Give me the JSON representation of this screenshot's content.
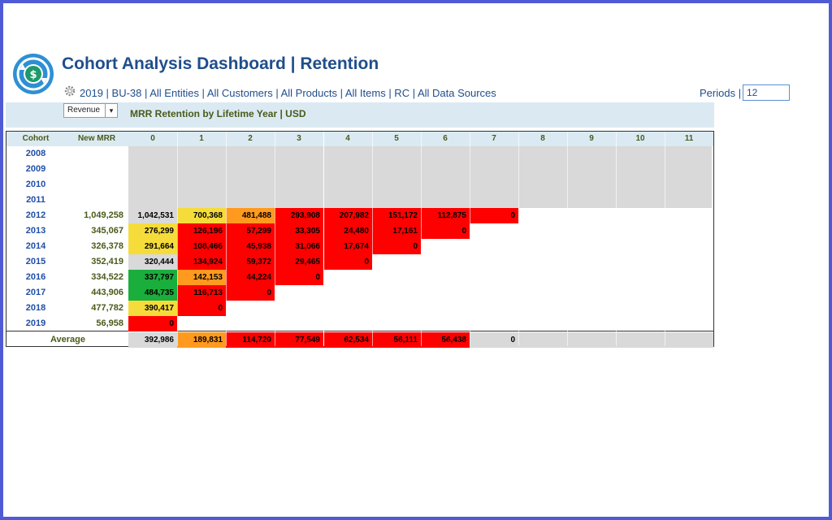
{
  "dashboard": {
    "title": "Cohort Analysis Dashboard | Retention",
    "filters": "2019 | BU-38 | All Entities | All Customers | All Products | All Items | RC | All Data Sources",
    "periods_label": "Periods |",
    "periods_value": "12",
    "metric_select": "Revenue",
    "subtitle": "MRR Retention by Lifetime Year | USD"
  },
  "colors": {
    "red": "#ff0000",
    "orange": "#ff9a1f",
    "yellow": "#f5dc3b",
    "green": "#1aae3c",
    "gray": "#d9d9d9",
    "header": "#dbeaf2",
    "accent": "#1f4e8c"
  },
  "icons": {
    "logo": "dollar-cycle-icon",
    "settings": "gear-icon",
    "dropdown": "chevron-down-icon"
  },
  "table": {
    "headers": {
      "cohort": "Cohort",
      "new_mrr": "New MRR",
      "periods": [
        "0",
        "1",
        "2",
        "3",
        "4",
        "5",
        "6",
        "7",
        "8",
        "9",
        "10",
        "11"
      ]
    },
    "rows": [
      {
        "cohort": "2008",
        "new_mrr": "",
        "cells": []
      },
      {
        "cohort": "2009",
        "new_mrr": "",
        "cells": []
      },
      {
        "cohort": "2010",
        "new_mrr": "",
        "cells": []
      },
      {
        "cohort": "2011",
        "new_mrr": "",
        "cells": []
      },
      {
        "cohort": "2012",
        "new_mrr": "1,049,258",
        "cells": [
          {
            "v": "1,042,531",
            "c": "gray"
          },
          {
            "v": "700,368",
            "c": "yellow"
          },
          {
            "v": "481,488",
            "c": "orange"
          },
          {
            "v": "293,908",
            "c": "red"
          },
          {
            "v": "207,982",
            "c": "red"
          },
          {
            "v": "151,172",
            "c": "red"
          },
          {
            "v": "112,875",
            "c": "red"
          },
          {
            "v": "0",
            "c": "red"
          }
        ]
      },
      {
        "cohort": "2013",
        "new_mrr": "345,067",
        "cells": [
          {
            "v": "276,299",
            "c": "yellow"
          },
          {
            "v": "126,196",
            "c": "red"
          },
          {
            "v": "57,299",
            "c": "red"
          },
          {
            "v": "33,305",
            "c": "red"
          },
          {
            "v": "24,480",
            "c": "red"
          },
          {
            "v": "17,161",
            "c": "red"
          },
          {
            "v": "0",
            "c": "red"
          }
        ]
      },
      {
        "cohort": "2014",
        "new_mrr": "326,378",
        "cells": [
          {
            "v": "291,664",
            "c": "yellow"
          },
          {
            "v": "108,466",
            "c": "red"
          },
          {
            "v": "45,938",
            "c": "red"
          },
          {
            "v": "31,066",
            "c": "red"
          },
          {
            "v": "17,674",
            "c": "red"
          },
          {
            "v": "0",
            "c": "red"
          }
        ]
      },
      {
        "cohort": "2015",
        "new_mrr": "352,419",
        "cells": [
          {
            "v": "320,444",
            "c": "gray"
          },
          {
            "v": "134,924",
            "c": "red"
          },
          {
            "v": "59,372",
            "c": "red"
          },
          {
            "v": "29,465",
            "c": "red"
          },
          {
            "v": "0",
            "c": "red"
          }
        ]
      },
      {
        "cohort": "2016",
        "new_mrr": "334,522",
        "cells": [
          {
            "v": "337,797",
            "c": "green"
          },
          {
            "v": "142,153",
            "c": "orange"
          },
          {
            "v": "44,224",
            "c": "red"
          },
          {
            "v": "0",
            "c": "red"
          }
        ]
      },
      {
        "cohort": "2017",
        "new_mrr": "443,906",
        "cells": [
          {
            "v": "484,735",
            "c": "green"
          },
          {
            "v": "116,713",
            "c": "red"
          },
          {
            "v": "0",
            "c": "red"
          }
        ]
      },
      {
        "cohort": "2018",
        "new_mrr": "477,782",
        "cells": [
          {
            "v": "390,417",
            "c": "yellow"
          },
          {
            "v": "0",
            "c": "red"
          }
        ]
      },
      {
        "cohort": "2019",
        "new_mrr": "56,958",
        "cells": [
          {
            "v": "0",
            "c": "red"
          }
        ]
      }
    ],
    "average": {
      "label": "Average",
      "cells": [
        {
          "v": "392,986",
          "c": "gray"
        },
        {
          "v": "189,831",
          "c": "orange"
        },
        {
          "v": "114,720",
          "c": "red"
        },
        {
          "v": "77,549",
          "c": "red"
        },
        {
          "v": "62,534",
          "c": "red"
        },
        {
          "v": "56,111",
          "c": "red"
        },
        {
          "v": "56,438",
          "c": "red"
        },
        {
          "v": "0",
          "c": "gray"
        },
        {
          "v": "",
          "c": "gray"
        },
        {
          "v": "",
          "c": "gray"
        },
        {
          "v": "",
          "c": "gray"
        },
        {
          "v": "",
          "c": "gray"
        }
      ]
    }
  }
}
